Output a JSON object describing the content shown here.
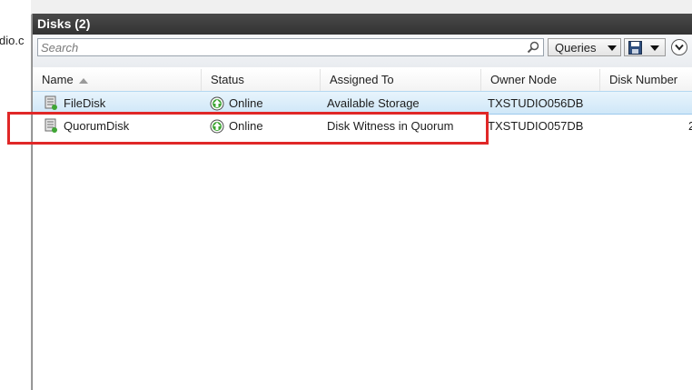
{
  "nav": {
    "truncated_text": "dio.c"
  },
  "pane": {
    "title": "Disks (2)"
  },
  "toolbar": {
    "search_placeholder": "Search",
    "queries_label": "Queries",
    "search_icon": "magnifier-icon",
    "save_icon": "floppy-disk-icon",
    "expand_icon": "chevron-down-circle-icon"
  },
  "grid": {
    "columns": [
      "Name",
      "Status",
      "Assigned To",
      "Owner Node",
      "Disk Number"
    ],
    "sort_column": "Name",
    "sort_direction": "ascending",
    "rows": [
      {
        "name": "FileDisk",
        "status": "Online",
        "assigned_to": "Available Storage",
        "owner_node": "TXSTUDIO056DB",
        "disk_number": "",
        "selected": true
      },
      {
        "name": "QuorumDisk",
        "status": "Online",
        "assigned_to": "Disk Witness in Quorum",
        "owner_node": "TXSTUDIO057DB",
        "disk_number": "2",
        "selected": false
      }
    ]
  },
  "highlight": {
    "color": "#e02727",
    "target_row": "QuorumDisk"
  },
  "colors": {
    "header_bg": "#3c3c3c",
    "selected_row": "#cfe7f8",
    "status_online": "#3fa535"
  }
}
